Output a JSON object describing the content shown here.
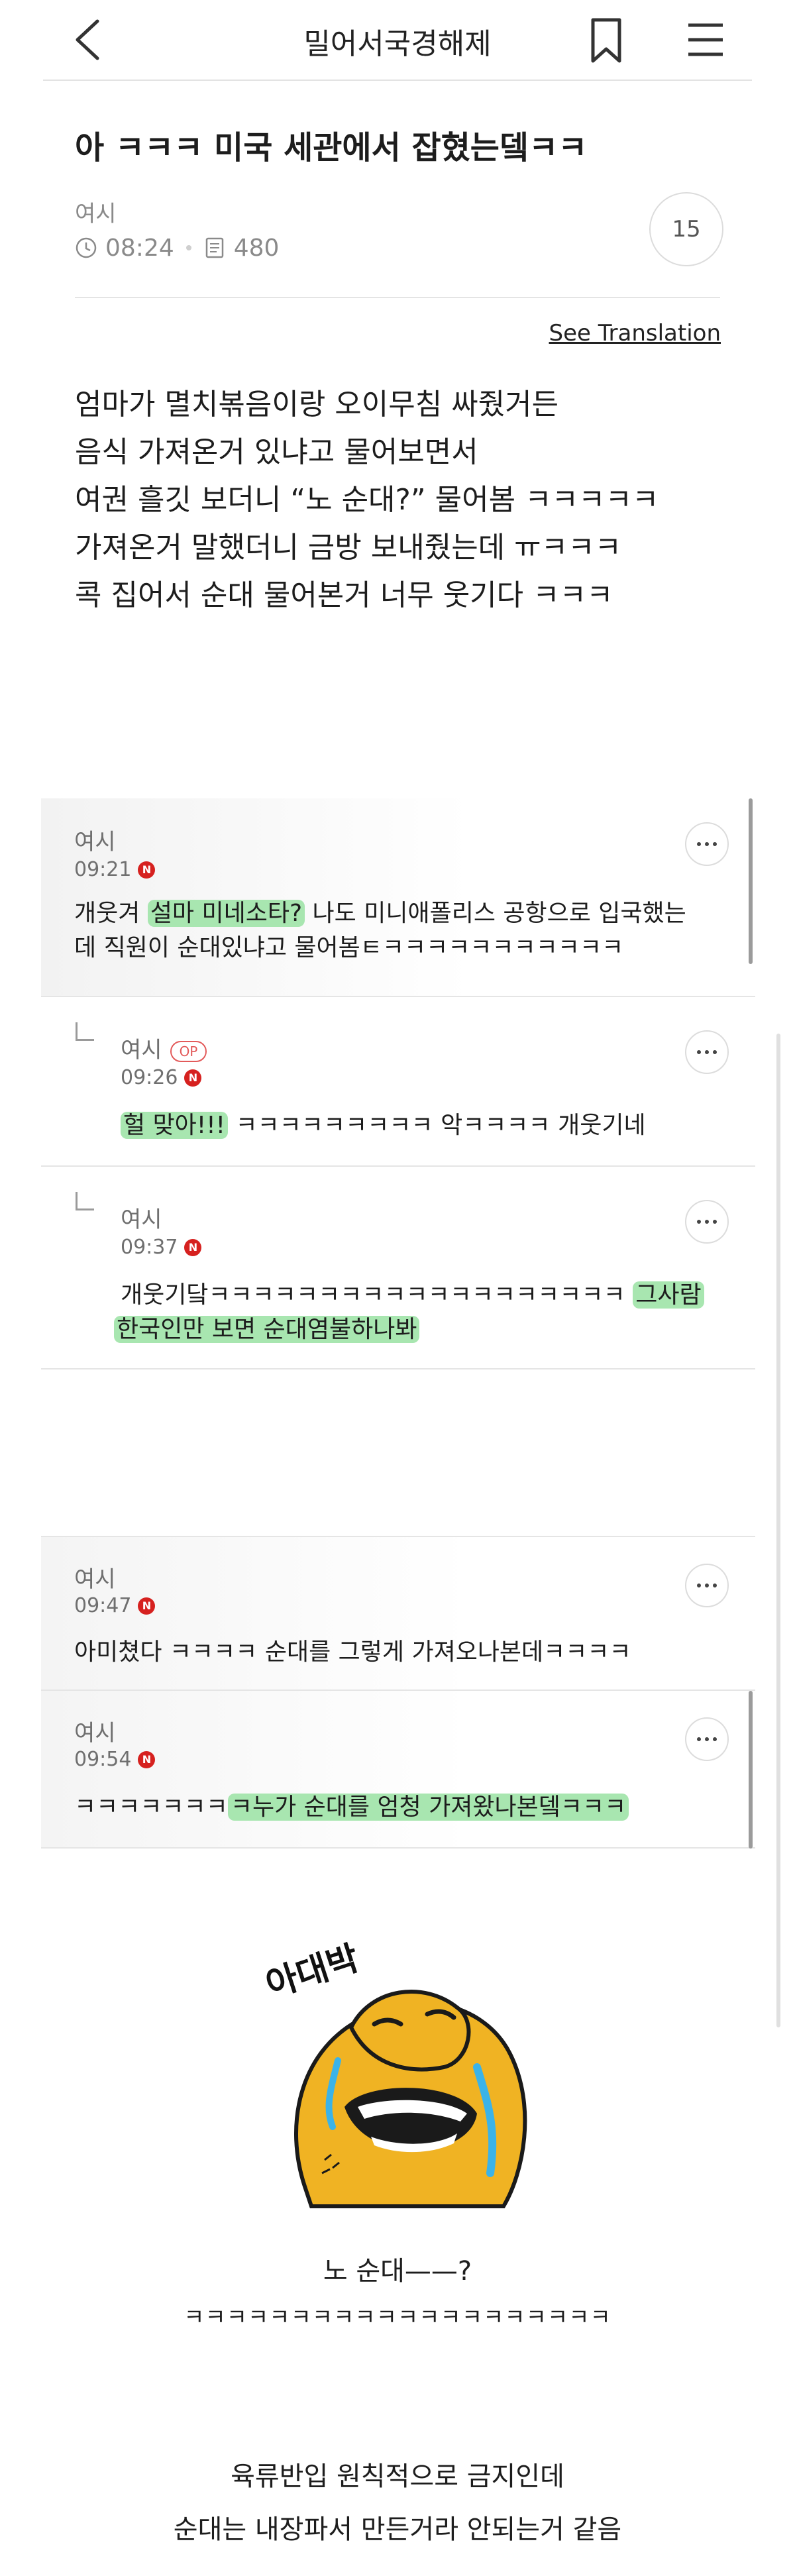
{
  "header": {
    "title": "밀어서국경해제"
  },
  "post": {
    "title": "아 ㅋㅋㅋ 미국 세관에서 잡혔는뎈ㅋㅋ",
    "author": "여시",
    "time": "08:24",
    "views": "480",
    "comment_count": "15",
    "translate_label": "See Translation",
    "body_lines": [
      "엄마가 멸치볶음이랑 오이무침 싸줬거든",
      "음식 가져온거 있냐고 물어보면서",
      "여권 흘깃 보더니 “노 순대?” 물어봄 ㅋㅋㅋㅋㅋ",
      "가져온거 말했더니 금방 보내줬는데 ㅠㅋㅋㅋ",
      "콕 집어서 순대 물어본거 너무 웃기다 ㅋㅋㅋ"
    ]
  },
  "comments": [
    {
      "nick": "여시",
      "time": "09:21",
      "badge": "N",
      "line1_pre": "개웃겨 ",
      "line1_hl": "설마 미네소타?",
      "line1_post": " 나도 미니애폴리스 공항으로 입국했는",
      "line2": "데 직원이 순대있냐고 물어봄ㅌㅋㅋㅋㅋㅋㅋㅋㅋㅋㅋㅋ"
    },
    {
      "nick": "여시",
      "op": "OP",
      "time": "09:26",
      "badge": "N",
      "line1_hl": "헐 맞아!!!",
      "line1_post": " ㅋㅋㅋㅋㅋㅋㅋㅋㅋ 악ㅋㅋㅋㅋ 개웃기네"
    },
    {
      "nick": "여시",
      "time": "09:37",
      "badge": "N",
      "line1_pre": "개웃기닼ㅋㅋㅋㅋㅋㅋㅋㅋㅋㅋㅋㅋㅋㅋㅋㅋㅋㅋㅋ ",
      "line1_hl": "그사람",
      "line2_hl": "한국인만 보면 순대염불하나봐"
    },
    {
      "nick": "여시",
      "time": "09:47",
      "badge": "N",
      "line1": "아미쳤다 ㅋㅋㅋㅋ 순대를 그렇게 가져오나본데ㅋㅋㅋㅋ"
    },
    {
      "nick": "여시",
      "time": "09:54",
      "badge": "N",
      "line1_pre": "ㅋㅋㅋㅋㅋㅋㅋ",
      "line1_hl": "ㅋ누가 순대를 엄청 가져왔나본뎈ㅋㅋㅋ"
    }
  ],
  "meme": {
    "icon": "crying-laughing-character",
    "text": "아대박"
  },
  "captions": {
    "line1": "노 순대——?",
    "line2": "ㅋㅋㅋㅋㅋㅋㅋㅋㅋㅋㅋㅋㅋㅋㅋㅋㅋㅋㅋㅋ",
    "line3": "육류반입 원칙적으로 금지인데",
    "line4": "순대는 내장파서 만든거라 안되는거 같음"
  },
  "colors": {
    "highlight": "#a8e6b0",
    "new_badge": "#d6211f",
    "op_badge": "#e35a5a"
  }
}
